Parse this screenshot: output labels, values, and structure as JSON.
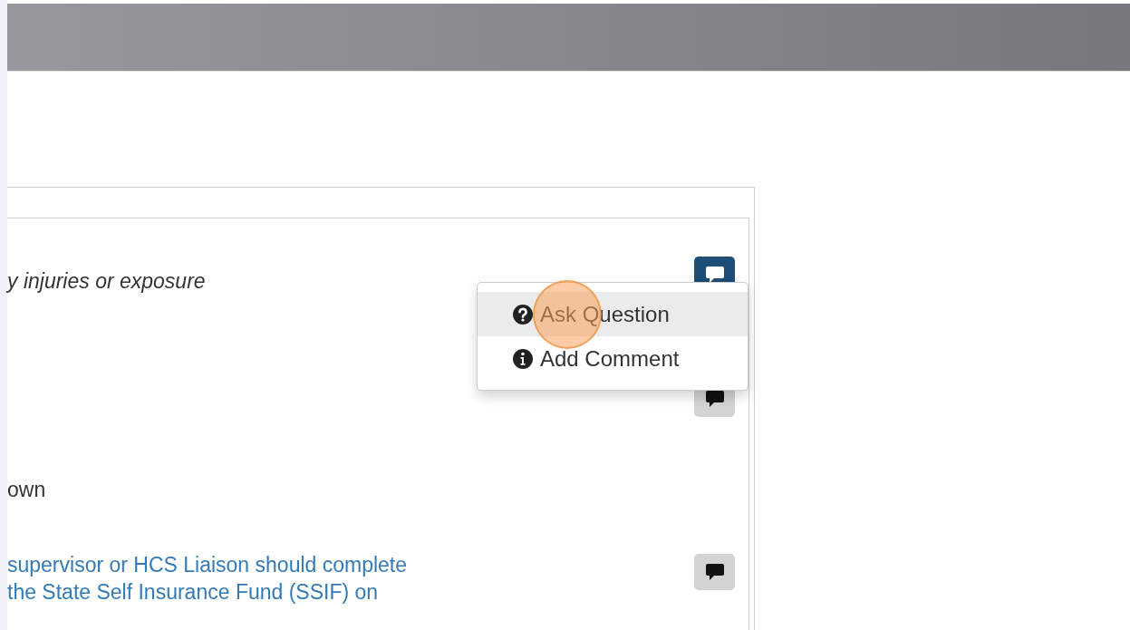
{
  "rows": [
    {
      "kind": "italic",
      "text": "y injuries or exposure",
      "comment_active": true
    },
    {
      "kind": "empty",
      "comment_active": false
    },
    {
      "kind": "plain",
      "text": "own"
    },
    {
      "kind": "link",
      "lines": [
        "supervisor or HCS Liaison should complete",
        "the State Self Insurance Fund (SSIF) on"
      ],
      "comment_active": false
    }
  ],
  "menu": {
    "items": [
      {
        "kind": "question",
        "label": "Ask Question",
        "selected": true
      },
      {
        "kind": "info",
        "label": "Add Comment",
        "selected": false
      }
    ]
  }
}
